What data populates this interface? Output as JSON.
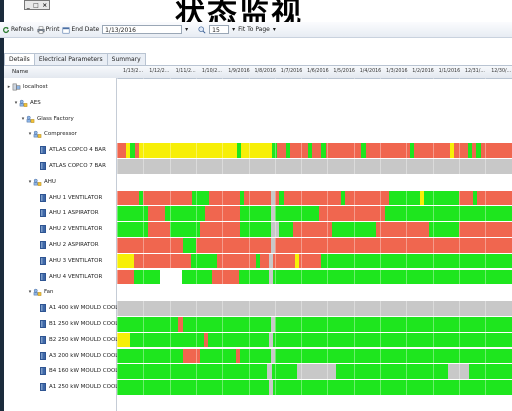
{
  "page_title": "状态监视",
  "window_buttons": [
    "_",
    "□",
    "×"
  ],
  "toolbar": {
    "refresh_label": "Refresh",
    "print_label": "Print",
    "end_date_label": "End Date",
    "end_date_value": "1/13/2016",
    "zoom_value": "15",
    "fit_label": "Fit To Page"
  },
  "tabs": [
    "Details",
    "Electrical Parameters",
    "Summary"
  ],
  "grid": {
    "name_header": "Name",
    "date_headers": [
      "1/13/2...",
      "1/12/2...",
      "1/11/2...",
      "1/10/2...",
      "1/9/2016",
      "1/8/2016",
      "1/7/2016",
      "1/6/2016",
      "1/5/2016",
      "1/4/2016",
      "1/3/2016",
      "1/2/2016",
      "1/1/2016",
      "12/31/...",
      "12/30/..."
    ]
  },
  "tree": [
    {
      "label": "localhost",
      "level": 0,
      "type": "server",
      "expander": "▸"
    },
    {
      "label": "AES",
      "level": 1,
      "type": "group",
      "expander": "▾"
    },
    {
      "label": "Glass Factory",
      "level": 2,
      "type": "group",
      "expander": "▾"
    },
    {
      "label": "Compressor",
      "level": 3,
      "type": "group",
      "expander": "▾"
    },
    {
      "label": "ATLAS COPCO 4 BAR",
      "level": 4,
      "type": "device",
      "expander": ""
    },
    {
      "label": "ATLAS COPCO 7 BAR",
      "level": 4,
      "type": "device",
      "expander": ""
    },
    {
      "label": "AHU",
      "level": 3,
      "type": "group",
      "expander": "▾"
    },
    {
      "label": "AHU 1 VENTILATOR",
      "level": 4,
      "type": "device",
      "expander": ""
    },
    {
      "label": "AHU 1 ASPIRATOR",
      "level": 4,
      "type": "device",
      "expander": ""
    },
    {
      "label": "AHU 2 VENTILATOR",
      "level": 4,
      "type": "device",
      "expander": ""
    },
    {
      "label": "AHU 2 ASPIRATOR",
      "level": 4,
      "type": "device",
      "expander": ""
    },
    {
      "label": "AHU 3 VENTILATOR",
      "level": 4,
      "type": "device",
      "expander": ""
    },
    {
      "label": "AHU 4 VENTILATOR",
      "level": 4,
      "type": "device",
      "expander": ""
    },
    {
      "label": "Fan",
      "level": 3,
      "type": "group",
      "expander": "▾"
    },
    {
      "label": "A1 400 kW MOULD COOLI...",
      "level": 4,
      "type": "device",
      "expander": ""
    },
    {
      "label": "B1 250 kW MOULD COOLI...",
      "level": 4,
      "type": "device",
      "expander": ""
    },
    {
      "label": "B2 250 kW MOULD COOLI...",
      "level": 4,
      "type": "device",
      "expander": ""
    },
    {
      "label": "A3 200 kW MOULD COOLI...",
      "level": 4,
      "type": "device",
      "expander": ""
    },
    {
      "label": "B4 160 kW MOULD COOLI...",
      "level": 4,
      "type": "device",
      "expander": ""
    },
    {
      "label": "A1 250 kW MOULD COOLI...",
      "level": 4,
      "type": "device",
      "expander": ""
    }
  ],
  "status_colors": {
    "G": "#1ee61e",
    "R": "#f0664f",
    "Y": "#f7ef07",
    "S": "#c8c8c8",
    "W": "#ffffff"
  },
  "status_rows": {
    "4": "RRYGRYYYYYYYYYYYYYYYYYYYYYYGYYYYYYYGRRGRRRRGRRGRRRRRRRRGRRRRRRRRRRGRRRRRRRRYRRRGRGRRRRRRR",
    "5": "SSSSSSSSSSSSSSSSSSSSSSSSSSSSSSSSSSSSSSSSSSSSSSSSSSSSSSSSSSSSSSSSSSSSSSSSSSSSSSSSSSSSSSSSS",
    "7": "RRRRRGRRRRRRRRRRRGGGGRRRRRRRGRRRRRRSRGRRRRRRRRRRRRRGRRRRRRRRRRGGGGGGGYGGGGGGGGRRRGRRRRRRRR",
    "8": "GGGGGGGRRRRGGGGGGGGGRRRRRRRRGGGGGGGSGGGGGGGGGGRRRRRRRRRRRRRRRGGGGGGGGGGGGGGGGGGGGGGGGGGGGG",
    "9": "GGGGGGGRRRRRGGGGGGGRRRRRRRRRGGGGGGGSSGGGRRRRRRRRRGGGGGGGGGGRRRRRRRRRRRRGGGGGGGRRRRRRRRRRRR",
    "10": "RRRRRRRRRRRRRRRGGGRRRRRRRRRRRRRRRRRSRRRRRRRRRRRRRRRRRRRRRRRRRRRRRRRRRRRRRRRRRRRRRRRRRRRRRR",
    "11": "YYYYRRRRRRRRRRRRRGGGGGGRRRRRRRRRGRRSRRRRRYRRRRRGGGGGGGGGGGGGGGGGGGGGGGGGGGGGGGGGGGGGGGGGGGG",
    "12": "RRRRGGGGGGWWWWWGGGGGGGRRRRRRGGGGGGGSGGGGGGGGGGGGGGGGGGGGGGGGGGGGGGGGGGGGGGGGGGGGGGGGGGGGGGG",
    "14": "SSSSSSSSSSSSSSSSSSSSSSSSSSSSSSSSSSSSSSSSSSSSSSSSSSSSSSSSSSSSSSSSSSSSSSSSSSSSSSSSSSSSSSSSSSSS",
    "15": "GGGGGGGGGGGGGGRGGGGGGGGGGGGGGGGGGGGSGGGGGGGGGGGGGGGGGGGGGGGGGGGGGGGGGGGGGGGGGGGGGGGGGGGGGG",
    "16": "YYYGGGGGGGGGGGGGGGGGRGGGGGGGGGGGGGGSGGGGGGGGGGGGGGGGGGGGGGGGGGGGGGGGGGGGGGGGGGGGGGGGGGGGGGG",
    "17": "GGGGGGGGGGGGGGGRRRRGGGGGGGGRGGGGGGGSGGGGGGGGGGGGGGGGGGGGGGGGGGGGGGGGGGGGGGGGGGGGGGGGGGGGGG",
    "18": "GGGGGGGGGGGGGGGGGGGGGGGGGGGGGGGGGGGSGGGGGGSSSSSSSSSGGGGGGGGGGGGGGGGGGGGGGGGGGSSSSSGGGGGGGGGG",
    "19": "GGGGGGGGGGGGGGGGGGGGGGGGGGGGGGGGGGGSGGGGGGGGGGGGGGGGGGGGGGGGGGGGGGGGGGGGGGGGGGGGGGGGGGGGGGG"
  }
}
